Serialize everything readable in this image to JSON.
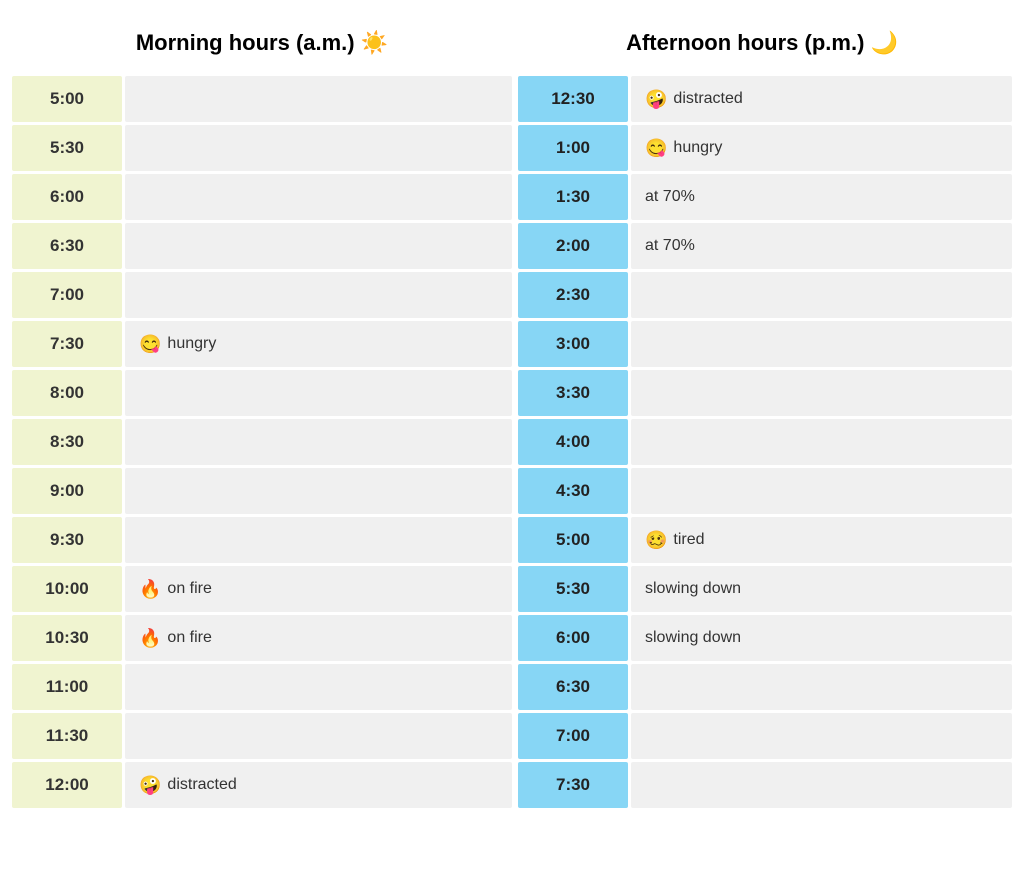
{
  "header": {
    "am_label": "Morning hours (a.m.) ☀️",
    "pm_label": "Afternoon hours (p.m.) 🌙"
  },
  "am_rows": [
    {
      "time": "5:00",
      "emoji": "",
      "text": ""
    },
    {
      "time": "5:30",
      "emoji": "",
      "text": ""
    },
    {
      "time": "6:00",
      "emoji": "",
      "text": ""
    },
    {
      "time": "6:30",
      "emoji": "",
      "text": ""
    },
    {
      "time": "7:00",
      "emoji": "",
      "text": ""
    },
    {
      "time": "7:30",
      "emoji": "😋",
      "text": "hungry"
    },
    {
      "time": "8:00",
      "emoji": "",
      "text": ""
    },
    {
      "time": "8:30",
      "emoji": "",
      "text": ""
    },
    {
      "time": "9:00",
      "emoji": "",
      "text": ""
    },
    {
      "time": "9:30",
      "emoji": "",
      "text": ""
    },
    {
      "time": "10:00",
      "emoji": "🔥",
      "text": "on fire"
    },
    {
      "time": "10:30",
      "emoji": "🔥",
      "text": "on fire"
    },
    {
      "time": "11:00",
      "emoji": "",
      "text": ""
    },
    {
      "time": "11:30",
      "emoji": "",
      "text": ""
    },
    {
      "time": "12:00",
      "emoji": "🤪",
      "text": "distracted"
    }
  ],
  "pm_rows": [
    {
      "time": "12:30",
      "emoji": "🤪",
      "text": "distracted"
    },
    {
      "time": "1:00",
      "emoji": "😋",
      "text": "hungry"
    },
    {
      "time": "1:30",
      "emoji": "",
      "text": "at 70%"
    },
    {
      "time": "2:00",
      "emoji": "",
      "text": "at 70%"
    },
    {
      "time": "2:30",
      "emoji": "",
      "text": ""
    },
    {
      "time": "3:00",
      "emoji": "",
      "text": ""
    },
    {
      "time": "3:30",
      "emoji": "",
      "text": ""
    },
    {
      "time": "4:00",
      "emoji": "",
      "text": ""
    },
    {
      "time": "4:30",
      "emoji": "",
      "text": ""
    },
    {
      "time": "5:00",
      "emoji": "🥴",
      "text": "tired"
    },
    {
      "time": "5:30",
      "emoji": "",
      "text": "slowing down"
    },
    {
      "time": "6:00",
      "emoji": "",
      "text": "slowing down"
    },
    {
      "time": "6:30",
      "emoji": "",
      "text": ""
    },
    {
      "time": "7:00",
      "emoji": "",
      "text": ""
    },
    {
      "time": "7:30",
      "emoji": "",
      "text": ""
    }
  ]
}
